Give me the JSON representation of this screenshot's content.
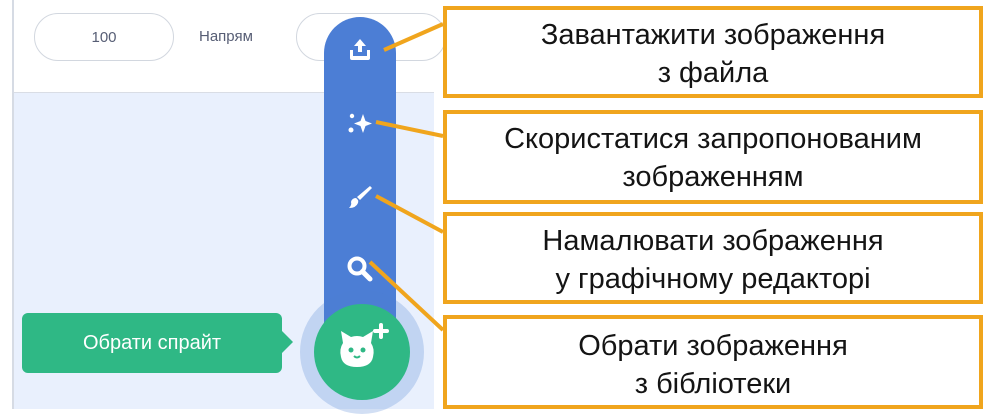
{
  "sprite_info": {
    "size_value": "100",
    "direction_label": "Напрям",
    "direction_value": ""
  },
  "sprite_menu": {
    "items": [
      {
        "icon": "upload-icon"
      },
      {
        "icon": "surprise-sparkle-icon"
      },
      {
        "icon": "paintbrush-icon"
      },
      {
        "icon": "search-icon"
      }
    ],
    "choose_sprite_label": "Обрати спрайт",
    "choose_sprite_icon": "cat-plus-icon"
  },
  "callouts": {
    "upload": {
      "line1": "Завантажити зображення",
      "line2": "з файла"
    },
    "surprise": {
      "line1": "Скористатися запропонованим",
      "line2": "зображенням"
    },
    "paint": {
      "line1": "Намалювати зображення",
      "line2": "у графічному редакторі"
    },
    "library": {
      "line1": "Обрати зображення",
      "line2": "з бібліотеки"
    }
  },
  "colors": {
    "menu_blue": "#4c7ed5",
    "scratch_green": "#2fb885",
    "callout_orange": "#f0a51d"
  }
}
